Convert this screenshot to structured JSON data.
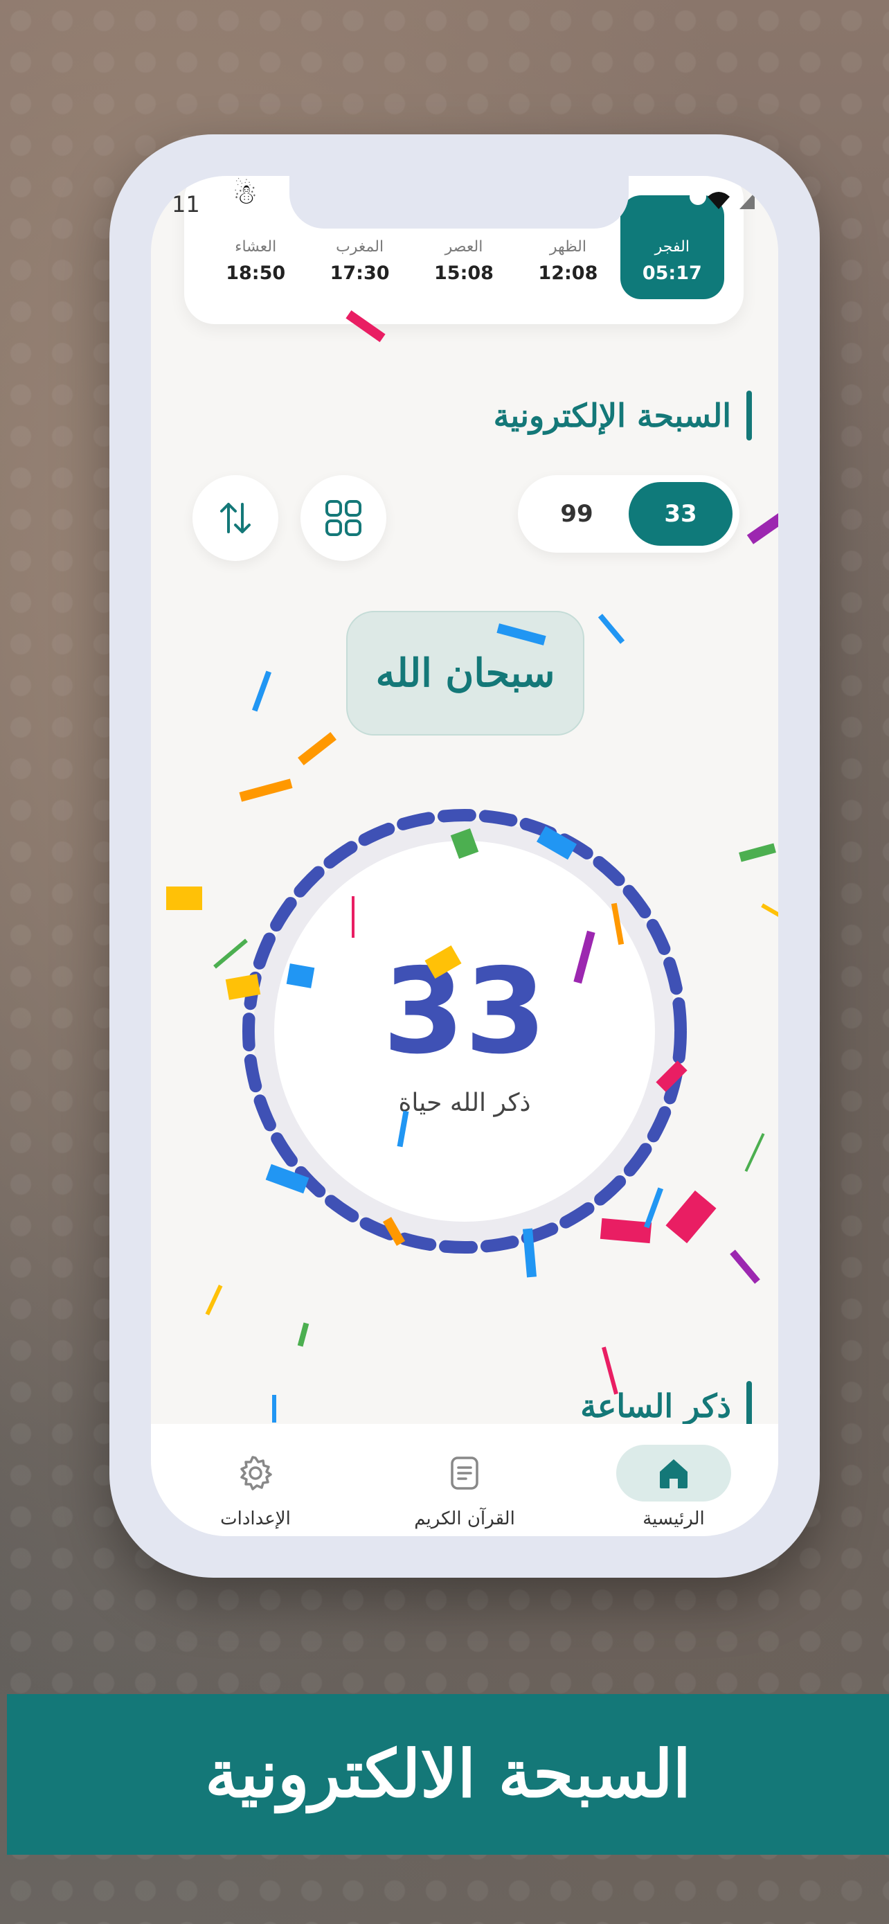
{
  "status_bar": {
    "time": "11"
  },
  "prayer_times": [
    {
      "name": "الفجر",
      "time": "05:17",
      "active": true
    },
    {
      "name": "الظهر",
      "time": "12:08",
      "active": false
    },
    {
      "name": "العصر",
      "time": "15:08",
      "active": false
    },
    {
      "name": "المغرب",
      "time": "17:30",
      "active": false
    },
    {
      "name": "العشاء",
      "time": "18:50",
      "active": false
    }
  ],
  "tasbih_section": {
    "title": "السبحة الإلكترونية",
    "count_options": [
      "33",
      "99"
    ],
    "selected_count": "33",
    "current_dhikr": "سبحان الله",
    "counter_value": "33",
    "counter_caption": "ذكر الله حياة"
  },
  "next_section": {
    "title": "ذكر الساعة"
  },
  "bottom_nav": [
    {
      "label": "الرئيسية",
      "icon": "home-icon",
      "active": true
    },
    {
      "label": "القرآن الكريم",
      "icon": "document-icon",
      "active": false
    },
    {
      "label": "الإعدادات",
      "icon": "gear-icon",
      "active": false
    }
  ],
  "banner": {
    "text": "السبحة الالكترونية"
  },
  "colors": {
    "primary": "#147878",
    "counter": "#3f51b5",
    "background": "#f7f6f4"
  }
}
